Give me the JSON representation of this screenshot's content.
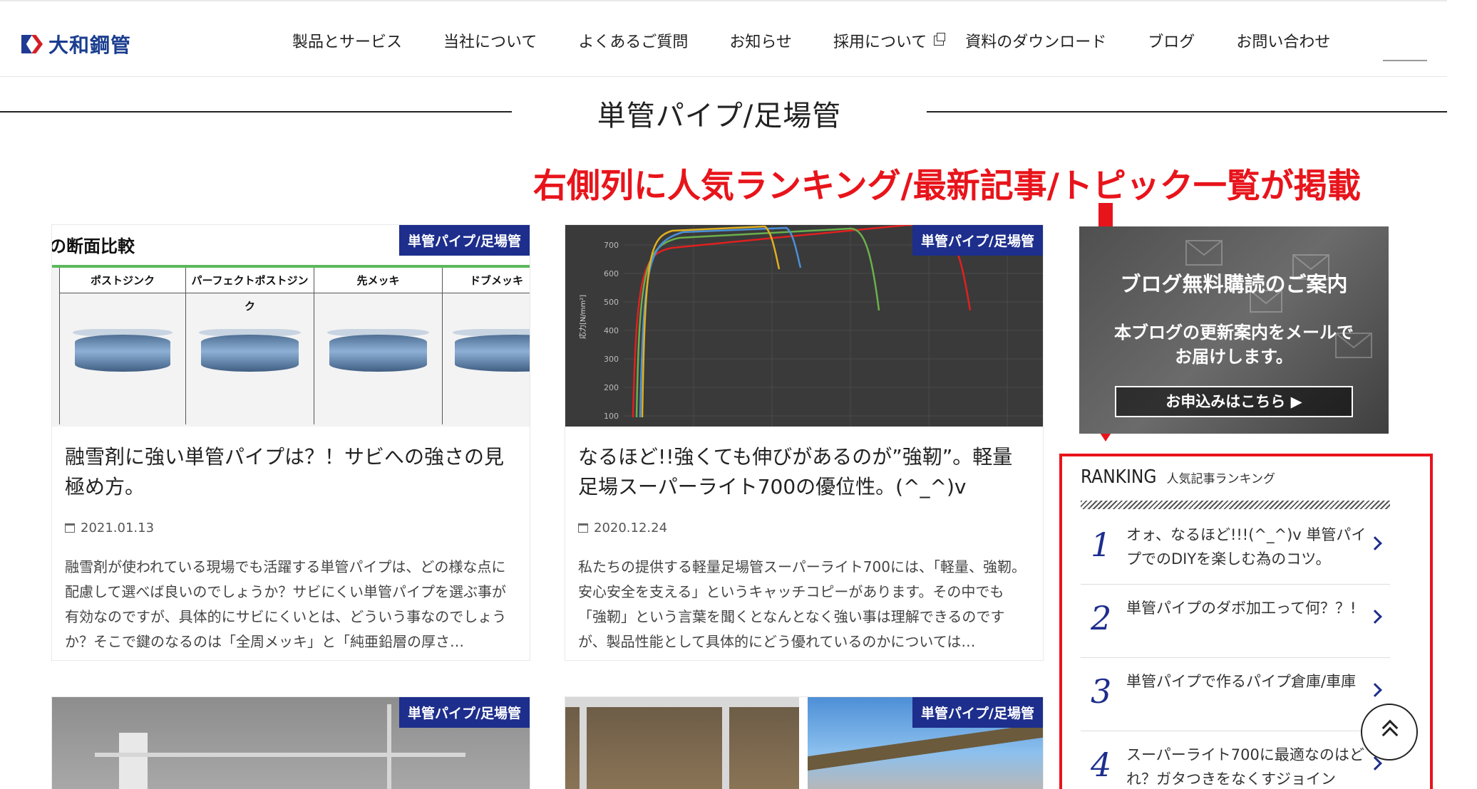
{
  "header": {
    "logo_text": "大和鋼管",
    "nav": [
      {
        "label": "製品とサービス"
      },
      {
        "label": "当社について"
      },
      {
        "label": "よくあるご質問"
      },
      {
        "label": "お知らせ"
      },
      {
        "label": "採用について"
      },
      {
        "label": "資料のダウンロード"
      },
      {
        "label": "ブログ"
      },
      {
        "label": "お問い合わせ"
      }
    ]
  },
  "section_title": "単管パイプ/足場管",
  "annotation": "右側列に人気ランキング/最新記事/トピック一覧が掲載",
  "colors": {
    "brand_navy": "#1d2e8c",
    "annotation_red": "#e8141b",
    "logo_blue": "#1a3d8f"
  },
  "cards": [
    {
      "category": "単管パイプ/足場管",
      "thumb_heading": "の断面比較",
      "thumb_columns": [
        "ポストジンク",
        "パーフェクトポストジンク",
        "先メッキ",
        "ドブメッキ"
      ],
      "title": "融雪剤に強い単管パイプは？！サビへの強さの見極め方。",
      "date": "2021.01.13",
      "excerpt": "融雪剤が使われている現場でも活躍する単管パイプは、どの様な点に配慮して選べば良いのでしょうか？サビにくい単管パイプを選ぶ事が有効なのですが、具体的にサビにくいとは、どういう事なのでしょうか？そこで鍵のなるのは「全周メッキ」と「純亜鉛層の厚さ…"
    },
    {
      "category": "単管パイプ/足場管",
      "thumb_axis_label": "応力[N/mm²]",
      "thumb_ticks": [
        "700",
        "600",
        "500",
        "400",
        "300",
        "200",
        "100"
      ],
      "title": "なるほど!!強くても伸びがあるのが”強靭”。軽量足場スーパーライト700の優位性。(^_^)v",
      "date": "2020.12.24",
      "excerpt": "私たちの提供する軽量足場管スーパーライト700には、「軽量、強靭。安心安全を支える」というキャッチコピーがあります。その中でも「強靭」という言葉を聞くとなんとなく強い事は理解できるのですが、製品性能として具体的にどう優れているのかについては…"
    },
    {
      "category": "単管パイプ/足場管"
    },
    {
      "category": "単管パイプ/足場管"
    }
  ],
  "sidebar": {
    "banner": {
      "title": "ブログ無料購読のご案内",
      "desc_line1": "本ブログの更新案内をメールで",
      "desc_line2": "お届けします。",
      "button": "お申込みはこちら ▶"
    },
    "ranking": {
      "title_en": "RANKING",
      "title_ja": "人気記事ランキング",
      "items": [
        {
          "num": "1",
          "title": "オォ、なるほど!!!(^_^)v 単管パイプでのDIYを楽しむ為のコツ。"
        },
        {
          "num": "2",
          "title": "単管パイプのダボ加工って何？？!"
        },
        {
          "num": "3",
          "title": "単管パイプで作るパイプ倉庫/車庫"
        },
        {
          "num": "4",
          "title": "スーパーライト700に最適なのはどれ？ガタつきをなくすジョイン"
        }
      ]
    }
  }
}
